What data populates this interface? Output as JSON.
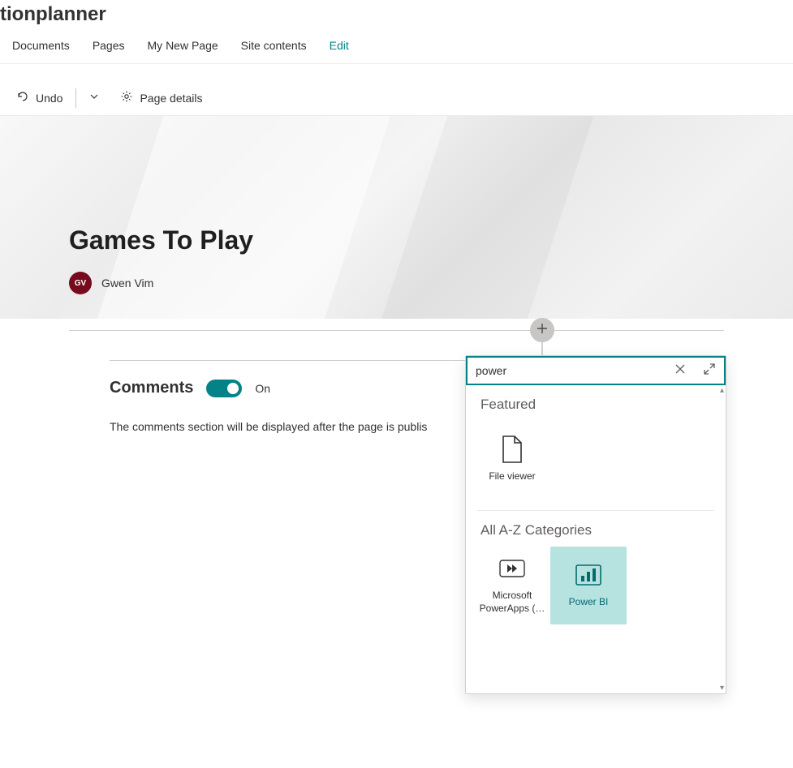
{
  "site": {
    "title_fragment": "tionplanner"
  },
  "nav": {
    "items": [
      {
        "label": "Documents"
      },
      {
        "label": "Pages"
      },
      {
        "label": "My New Page"
      },
      {
        "label": "Site contents"
      },
      {
        "label": "Edit",
        "active": true
      }
    ]
  },
  "toolbar": {
    "undo_label": "Undo",
    "page_details_label": "Page details"
  },
  "hero": {
    "title": "Games To Play",
    "author_initials": "GV",
    "author_name": "Gwen Vim"
  },
  "comments": {
    "label": "Comments",
    "state_label": "On",
    "description": "The comments section will be displayed after the page is publis"
  },
  "picker": {
    "search_value": "power",
    "sections": {
      "featured": {
        "title": "Featured",
        "items": [
          {
            "label": "File viewer",
            "icon": "file"
          }
        ]
      },
      "all": {
        "title": "All A-Z Categories",
        "items": [
          {
            "label": "Microsoft PowerApps (…",
            "icon": "powerapps"
          },
          {
            "label": "Power BI",
            "icon": "powerbi",
            "selected": true
          }
        ]
      }
    }
  }
}
